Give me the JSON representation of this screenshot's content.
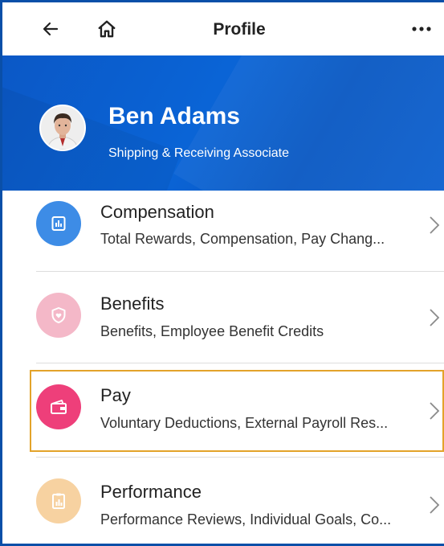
{
  "header": {
    "title": "Profile",
    "back_icon": "arrow-left-icon",
    "home_icon": "home-icon",
    "more_icon": "more-horizontal-icon"
  },
  "profile": {
    "name": "Ben Adams",
    "role": "Shipping & Receiving Associate",
    "hero_color": "#0a5fd0"
  },
  "items": [
    {
      "label": "Compensation",
      "sub": "Total Rewards, Compensation, Pay Chang...",
      "icon": "chart-icon",
      "icon_color": "#3d8ce6"
    },
    {
      "label": "Benefits",
      "sub": "Benefits, Employee Benefit Credits",
      "icon": "shield-heart-icon",
      "icon_color": "#f4b8c8"
    },
    {
      "label": "Pay",
      "sub": "Voluntary Deductions, External Payroll Res...",
      "icon": "wallet-icon",
      "icon_color": "#ee3f7a"
    },
    {
      "label": "Performance",
      "sub": "Performance Reviews, Individual Goals, Co...",
      "icon": "clipboard-chart-icon",
      "icon_color": "#f7d2a1"
    }
  ],
  "highlight_color": "#e3a32a"
}
